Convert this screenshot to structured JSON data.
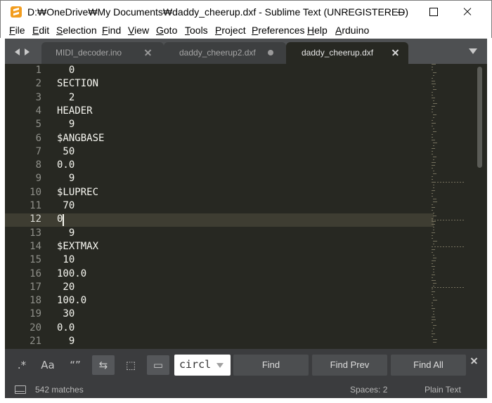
{
  "window": {
    "title": "D:₩OneDrive₩My Documents₩daddy_cheerup.dxf - Sublime Text (UNREGISTERED)"
  },
  "menu": {
    "items": [
      "File",
      "Edit",
      "Selection",
      "Find",
      "View",
      "Goto",
      "Tools",
      "Project",
      "Preferences",
      "Help",
      "Arduino"
    ]
  },
  "tabs": [
    {
      "label": "MIDI_decoder.ino",
      "state": "close"
    },
    {
      "label": "daddy_cheerup2.dxf",
      "state": "dirty"
    },
    {
      "label": "daddy_cheerup.dxf",
      "state": "active"
    }
  ],
  "editor": {
    "current_line": 12,
    "lines": [
      {
        "n": "1",
        "text": "  0"
      },
      {
        "n": "2",
        "text": "SECTION"
      },
      {
        "n": "3",
        "text": "  2"
      },
      {
        "n": "4",
        "text": "HEADER"
      },
      {
        "n": "5",
        "text": "  9"
      },
      {
        "n": "6",
        "text": "$ANGBASE"
      },
      {
        "n": "7",
        "text": " 50"
      },
      {
        "n": "8",
        "text": "0.0"
      },
      {
        "n": "9",
        "text": "  9"
      },
      {
        "n": "10",
        "text": "$LUPREC"
      },
      {
        "n": "11",
        "text": " 70"
      },
      {
        "n": "12",
        "text": "0"
      },
      {
        "n": "13",
        "text": "  9"
      },
      {
        "n": "14",
        "text": "$EXTMAX"
      },
      {
        "n": "15",
        "text": " 10"
      },
      {
        "n": "16",
        "text": "100.0"
      },
      {
        "n": "17",
        "text": " 20"
      },
      {
        "n": "18",
        "text": "100.0"
      },
      {
        "n": "19",
        "text": " 30"
      },
      {
        "n": "20",
        "text": "0.0"
      },
      {
        "n": "21",
        "text": "  9"
      }
    ]
  },
  "find": {
    "toggles": [
      {
        "name": "regex-toggle",
        "label": ".*",
        "on": false
      },
      {
        "name": "case-toggle",
        "label": "Aa",
        "on": false
      },
      {
        "name": "whole-word-toggle",
        "label": "“”",
        "on": false
      },
      {
        "name": "wrap-toggle",
        "label": "⇆",
        "on": true
      },
      {
        "name": "in-selection-toggle",
        "label": "⬚",
        "on": false
      },
      {
        "name": "highlight-matches-toggle",
        "label": "▭",
        "on": true
      }
    ],
    "query": "circl",
    "find_label": "Find",
    "find_prev_label": "Find Prev",
    "find_all_label": "Find All"
  },
  "status": {
    "matches": "542 matches",
    "spaces": "Spaces: 2",
    "syntax": "Plain Text"
  },
  "colors": {
    "editor_bg": "#272822",
    "text": "#f8f8f2",
    "gutter_text": "#8f908a",
    "panel_bg": "#3b3c3e"
  }
}
